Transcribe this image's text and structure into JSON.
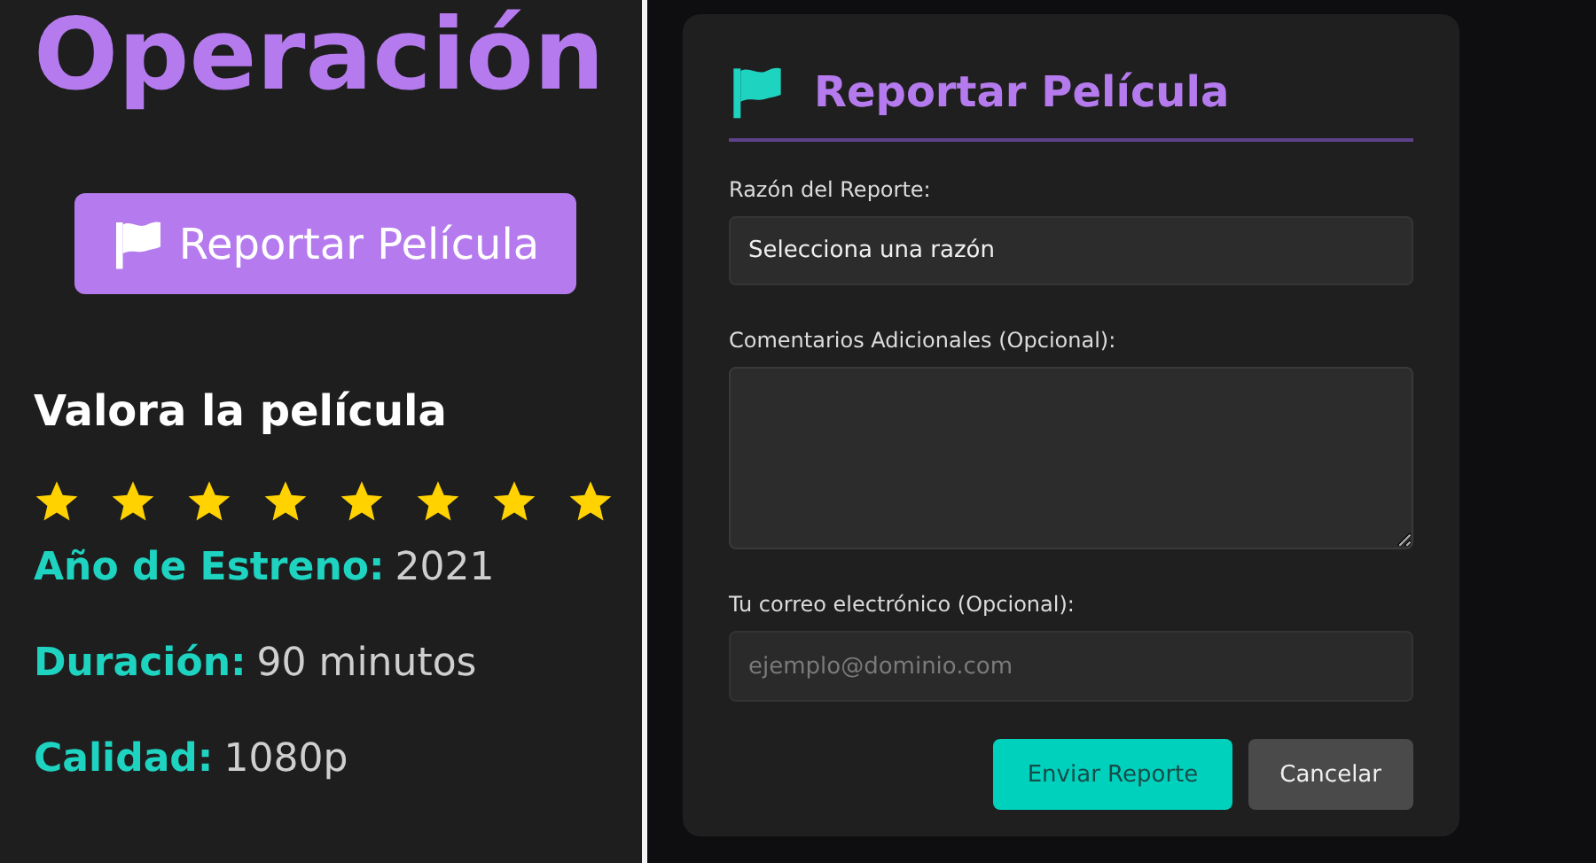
{
  "page": {
    "title": "Operación",
    "report_button": "Reportar Película",
    "rating_heading": "Valora la película",
    "rating": {
      "stars": 8
    },
    "details": [
      {
        "label": "Año de Estreno:",
        "value": "2021"
      },
      {
        "label": "Duración:",
        "value": "90 minutos"
      },
      {
        "label": "Calidad:",
        "value": "1080p"
      }
    ]
  },
  "modal": {
    "title": "Reportar Película",
    "fields": [
      {
        "kind": "select",
        "label": "Razón del Reporte:",
        "value": "Selecciona una razón"
      },
      {
        "kind": "textarea",
        "label": "Comentarios Adicionales (Opcional):"
      },
      {
        "kind": "input",
        "label": "Tu correo electrónico (Opcional):",
        "placeholder": "ejemplo@dominio.com"
      }
    ],
    "buttons": [
      {
        "kind": "primary",
        "label": "Enviar Reporte"
      },
      {
        "kind": "secondary",
        "label": "Cancelar"
      }
    ]
  }
}
